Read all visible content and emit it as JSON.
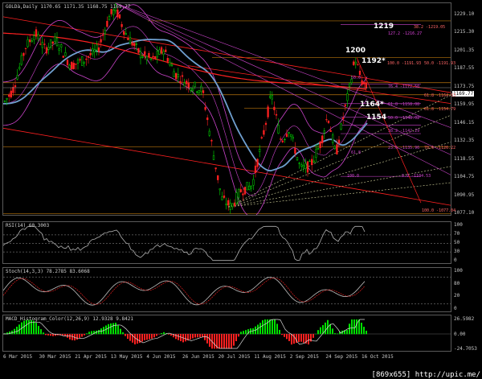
{
  "main_panel": {
    "title": "GOLDà,Daily  1170.65 1171.35 1168.75 1169.77",
    "current_price": "1169.77",
    "price_axis": [
      "1229.10",
      "1215.30",
      "1201.35",
      "1187.55",
      "1173.75",
      "1159.95",
      "1146.15",
      "1132.35",
      "1118.55",
      "1104.75",
      "1090.95",
      "1077.10"
    ],
    "annotations": [
      {
        "text": "1219",
        "color": "#ffffff"
      },
      {
        "text": "1200",
        "color": "#ffffff"
      },
      {
        "text": "1192*",
        "color": "#ffffff"
      },
      {
        "text": "1164*",
        "color": "#ffffff"
      },
      {
        "text": "1154",
        "color": "#ffffff"
      }
    ],
    "fib_labels": [
      {
        "text": "38.2 -1219.05",
        "color": "#ff6666"
      },
      {
        "text": "127.2 -1216.27",
        "color": "#dd44dd"
      },
      {
        "text": "100.0 -1191.93",
        "color": "#ff6666"
      },
      {
        "text": "50.0 -1191.93",
        "color": "#ff6666"
      },
      {
        "text": "76.4 -1172.50",
        "color": "#cc44cc"
      },
      {
        "text": "61.8 -1164.63",
        "color": "#ff6666"
      },
      {
        "text": "61.8 -1158.08",
        "color": "#cc44cc"
      },
      {
        "text": "61.8 -1154.79",
        "color": "#ff6666"
      },
      {
        "text": "50.0 -1148.02",
        "color": "#cc44cc"
      },
      {
        "text": "38.2 -1142.29",
        "color": "#cc44cc"
      },
      {
        "text": "23.6 -1135.96",
        "color": "#cc44cc"
      },
      {
        "text": "78.6 -1126.22",
        "color": "#ff6666"
      },
      {
        "text": "0.0 -1104.53",
        "color": "#cc44cc"
      },
      {
        "text": "100.0 -1077.04",
        "color": "#ff6666"
      },
      {
        "text": "50.0",
        "color": "#cc44cc"
      },
      {
        "text": "61.8",
        "color": "#cc44cc"
      },
      {
        "text": "100.0",
        "color": "#cc44cc"
      }
    ]
  },
  "rsi_panel": {
    "title": "RSI(14) 60.3003",
    "axis": [
      "100",
      "70",
      "50",
      "30",
      "0"
    ]
  },
  "stoch_panel": {
    "title": "Stoch(14,3,3) 78.2785 83.6068",
    "axis": [
      "100",
      "80",
      "20",
      "0"
    ]
  },
  "macd_panel": {
    "title": "MACD_Histogram_Color(12,26,9) 12.9328 9.8421",
    "axis": [
      "26.5982",
      "0.00",
      "-24.7053"
    ]
  },
  "time_axis": [
    "6 Mar 2015",
    "30 Mar 2015",
    "21 Apr 2015",
    "13 May 2015",
    "4 Jun 2015",
    "26 Jun 2015",
    "20 Jul 2015",
    "11 Aug 2015",
    "2 Sep 2015",
    "24 Sep 2015",
    "16 Oct 2015"
  ],
  "watermark": "[869x655] http://upic.me/",
  "colors": {
    "bull_candle": "#00e000",
    "bear_candle": "#ff2020",
    "ma_red": "#ff2020",
    "ma_blue": "#6f9fcf",
    "bollinger": "#cc44cc",
    "fib_orange": "#d98a10",
    "support_gold": "#c8a020",
    "macd_green": "#00e000",
    "macd_red": "#ff2020"
  }
}
